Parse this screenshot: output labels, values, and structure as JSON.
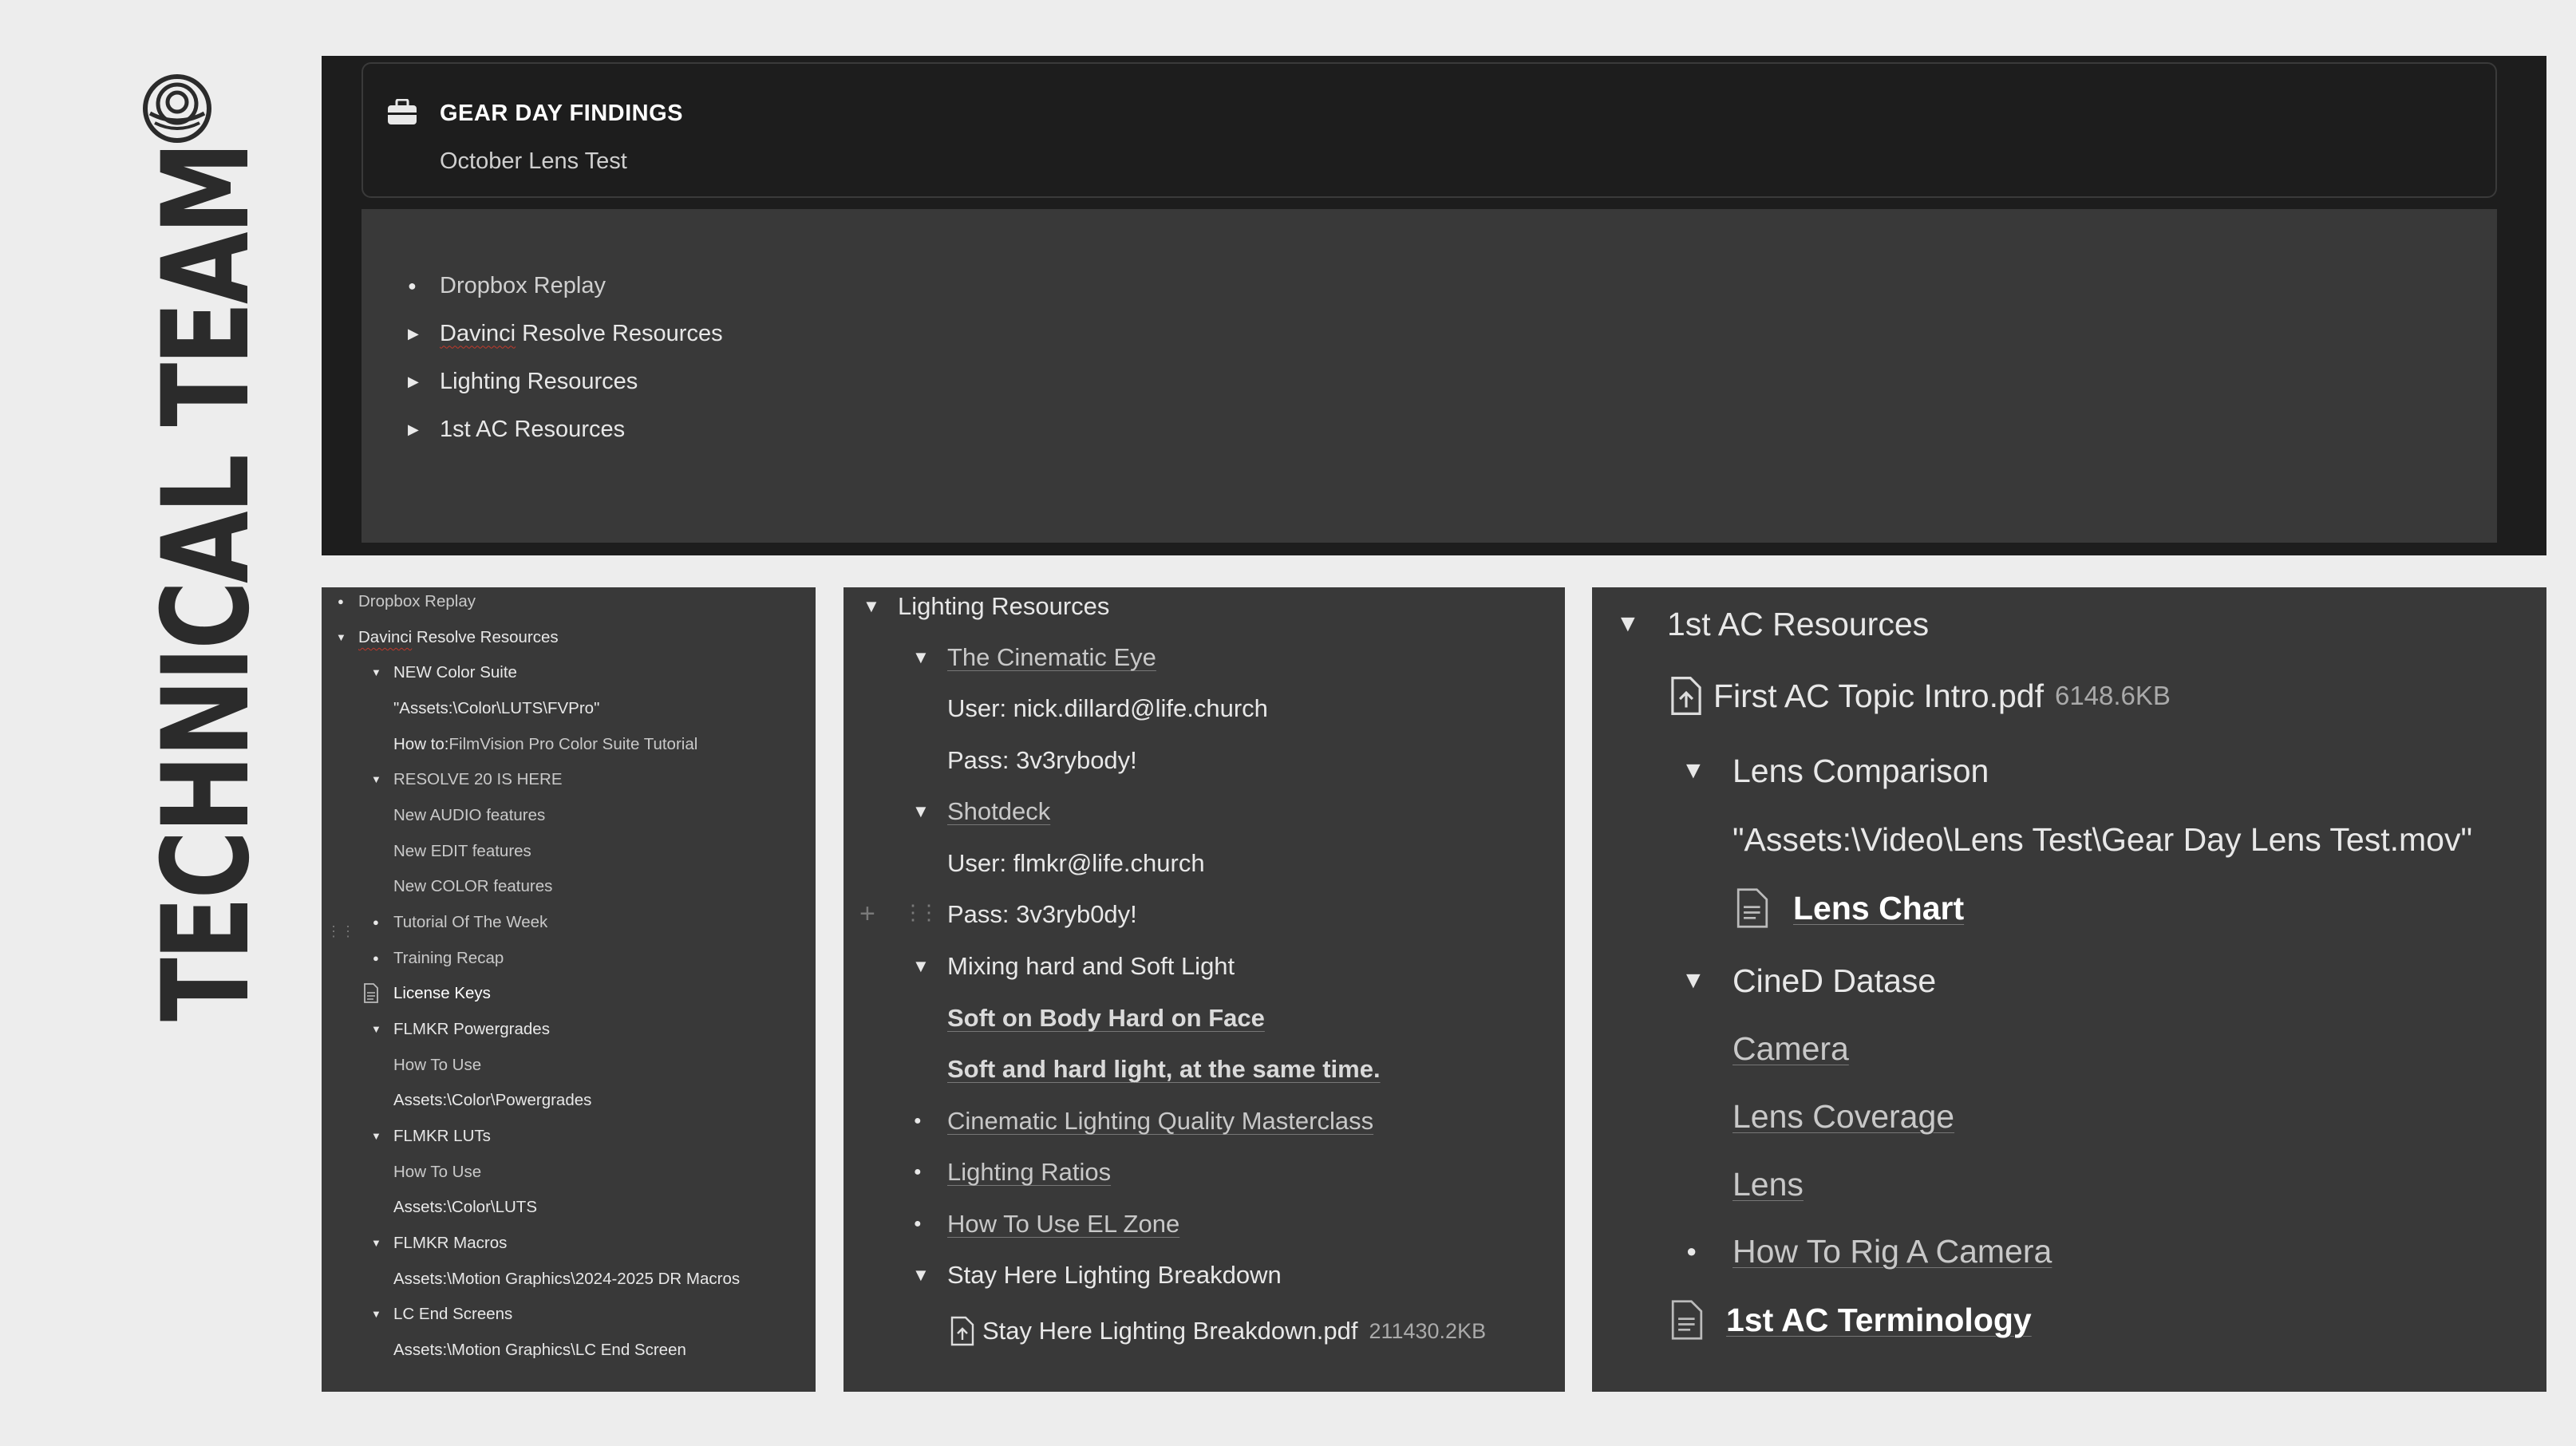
{
  "side_title": "TECHNICAL TEAM",
  "header": {
    "title": "GEAR DAY FINDINGS",
    "subtitle": "October Lens Test"
  },
  "top_list": [
    {
      "label": "Dropbox Replay",
      "marker": "bullet"
    },
    {
      "label_a": "Davinci",
      "label_b": " Resolve Resources",
      "marker": "toggle"
    },
    {
      "label": "Lighting Resources",
      "marker": "toggle"
    },
    {
      "label": "1st AC Resources",
      "marker": "toggle"
    }
  ],
  "panel_left": {
    "items": [
      {
        "label": "Dropbox Replay"
      },
      {
        "label_a": "Davinci",
        "label_b": " Resolve Resources"
      },
      {
        "label": "NEW Color Suite"
      },
      {
        "label": "\"Assets:\\Color\\LUTS\\FVPro\""
      },
      {
        "label_a": "How to: ",
        "label_b": "FilmVision Pro Color Suite Tutorial"
      },
      {
        "label": "RESOLVE 20 IS HERE"
      },
      {
        "label": "New AUDIO features"
      },
      {
        "label": "New EDIT features"
      },
      {
        "label": "New COLOR features"
      },
      {
        "label": "Tutorial Of The Week"
      },
      {
        "label": "Training Recap"
      },
      {
        "label": "License Keys"
      },
      {
        "label": "FLMKR Powergrades"
      },
      {
        "label": "How To Use"
      },
      {
        "label": "Assets:\\Color\\Powergrades"
      },
      {
        "label": "FLMKR LUTs"
      },
      {
        "label": "How To Use"
      },
      {
        "label": "Assets:\\Color\\LUTS"
      },
      {
        "label": "FLMKR Macros"
      },
      {
        "label": "Assets:\\Motion Graphics\\2024-2025 DR Macros"
      },
      {
        "label": "LC End Screens"
      },
      {
        "label": "Assets:\\Motion Graphics\\LC End Screen"
      }
    ]
  },
  "panel_mid": {
    "title": "Lighting Resources",
    "items": [
      {
        "label": "The Cinematic Eye"
      },
      {
        "label": "User: nick.dillard@life.church"
      },
      {
        "label": "Pass: 3v3rybody!"
      },
      {
        "label": "Shotdeck"
      },
      {
        "label": "User: flmkr@life.church"
      },
      {
        "label": "Pass: 3v3ryb0dy!"
      },
      {
        "label": "Mixing hard and Soft Light"
      },
      {
        "label": "Soft on Body Hard on Face"
      },
      {
        "label": "Soft and hard light, at the same time."
      },
      {
        "label": "Cinematic Lighting Quality Masterclass"
      },
      {
        "label": "Lighting Ratios"
      },
      {
        "label": "How To Use EL Zone"
      },
      {
        "label": "Stay Here Lighting Breakdown"
      },
      {
        "label": "Stay Here Lighting Breakdown.pdf",
        "size": "211430.2KB"
      }
    ]
  },
  "panel_right": {
    "title": "1st AC Resources",
    "items": [
      {
        "label": "First AC Topic Intro.pdf",
        "size": "6148.6KB"
      },
      {
        "label": "Lens Comparison"
      },
      {
        "label": "\"Assets:\\Video\\Lens Test\\Gear Day Lens Test.mov\""
      },
      {
        "label": "Lens Chart"
      },
      {
        "label": "CineD Datase"
      },
      {
        "label": "Camera"
      },
      {
        "label": "Lens Coverage"
      },
      {
        "label": "Lens"
      },
      {
        "label": "How To Rig A Camera"
      },
      {
        "label": "1st AC Terminology"
      }
    ]
  },
  "colors": {
    "page_bg": "#ededed",
    "header_bg": "#1d1d1d",
    "panel_bg": "#393939",
    "title_text": "#2b2b2b"
  }
}
